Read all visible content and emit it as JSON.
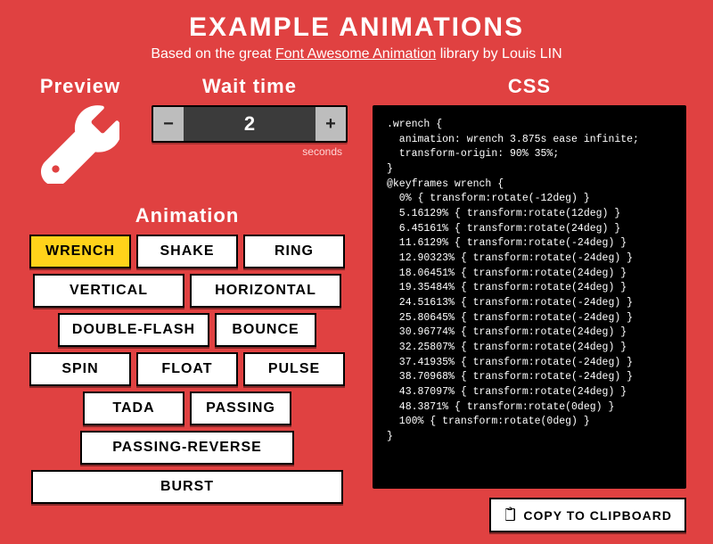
{
  "title": "EXAMPLE ANIMATIONS",
  "subtitle_pre": "Based on the great ",
  "subtitle_link": "Font Awesome Animation",
  "subtitle_post": " library by Louis LIN",
  "sections": {
    "preview": "Preview",
    "wait": "Wait time",
    "animation": "Animation",
    "css": "CSS"
  },
  "preview_icon": "wrench-icon",
  "wait": {
    "value": "2",
    "unit": "seconds",
    "minus": "−",
    "plus": "+"
  },
  "animations": [
    {
      "label": "WRENCH",
      "size": "w-s",
      "active": true
    },
    {
      "label": "SHAKE",
      "size": "w-s"
    },
    {
      "label": "RING",
      "size": "w-s"
    },
    {
      "label": "VERTICAL",
      "size": "w-m"
    },
    {
      "label": "HORIZONTAL",
      "size": "w-m"
    },
    {
      "label": "DOUBLE-FLASH",
      "size": "w-m"
    },
    {
      "label": "BOUNCE",
      "size": "w-s"
    },
    {
      "label": "SPIN",
      "size": "w-s"
    },
    {
      "label": "FLOAT",
      "size": "w-s"
    },
    {
      "label": "PULSE",
      "size": "w-s"
    },
    {
      "label": "TADA",
      "size": "w-s"
    },
    {
      "label": "PASSING",
      "size": "w-s"
    },
    {
      "label": "PASSING-REVERSE",
      "size": "w-l"
    },
    {
      "label": "BURST",
      "size": "w-xl"
    }
  ],
  "css_code": ".wrench {\n  animation: wrench 3.875s ease infinite;\n  transform-origin: 90% 35%;\n}\n@keyframes wrench {\n  0% { transform:rotate(-12deg) }\n  5.16129% { transform:rotate(12deg) }\n  6.45161% { transform:rotate(24deg) }\n  11.6129% { transform:rotate(-24deg) }\n  12.90323% { transform:rotate(-24deg) }\n  18.06451% { transform:rotate(24deg) }\n  19.35484% { transform:rotate(24deg) }\n  24.51613% { transform:rotate(-24deg) }\n  25.80645% { transform:rotate(-24deg) }\n  30.96774% { transform:rotate(24deg) }\n  32.25807% { transform:rotate(24deg) }\n  37.41935% { transform:rotate(-24deg) }\n  38.70968% { transform:rotate(-24deg) }\n  43.87097% { transform:rotate(24deg) }\n  48.3871% { transform:rotate(0deg) }\n  100% { transform:rotate(0deg) }\n}",
  "copy_label": "COPY TO CLIPBOARD"
}
